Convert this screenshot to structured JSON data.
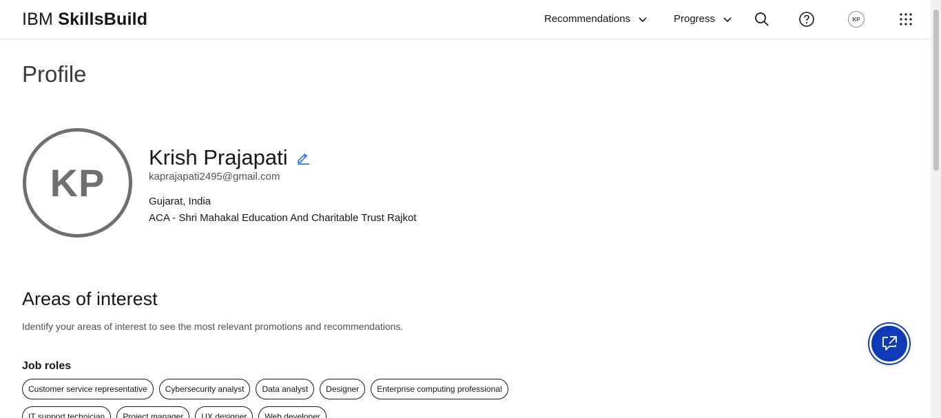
{
  "header": {
    "brand_prefix": "IBM",
    "brand_name": "SkillsBuild",
    "nav": [
      {
        "label": "Recommendations"
      },
      {
        "label": "Progress"
      }
    ],
    "avatar_initials": "KP"
  },
  "page": {
    "title": "Profile"
  },
  "profile": {
    "initials": "KP",
    "name": "Krish Prajapati",
    "email": "kaprajapati2495@gmail.com",
    "location": "Gujarat, India",
    "organization": "ACA - Shri Mahakal Education And Charitable Trust Rajkot"
  },
  "interests": {
    "title": "Areas of interest",
    "description": "Identify your areas of interest to see the most relevant promotions and recommendations.",
    "job_roles_title": "Job roles",
    "job_roles": [
      "Customer service representative",
      "Cybersecurity analyst",
      "Data analyst",
      "Designer",
      "Enterprise computing professional",
      "IT support technician",
      "Project manager",
      "UX designer",
      "Web developer"
    ]
  },
  "colors": {
    "accent": "#0f62fe",
    "fab": "#0f3ab5",
    "avatar_gray": "#6f6f6f"
  },
  "icons": [
    "chevron-down-icon",
    "search-icon",
    "help-icon",
    "app-switcher-icon",
    "edit-icon",
    "chat-launch-icon"
  ]
}
